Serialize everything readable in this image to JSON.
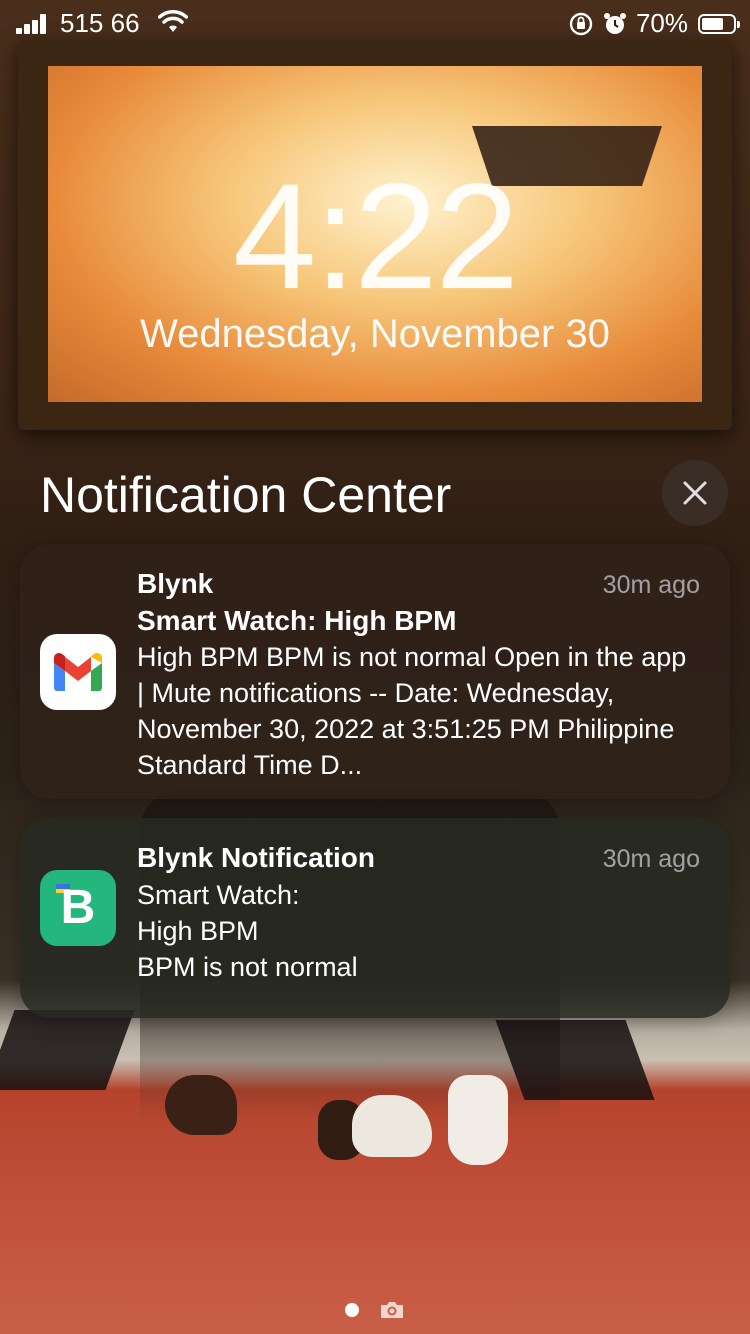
{
  "status_bar": {
    "carrier": "515 66",
    "signal_bars": 4,
    "battery_percent": "70%",
    "battery_level": 0.7,
    "icons": [
      "wifi-icon",
      "orientation-lock-icon",
      "alarm-icon",
      "battery-icon"
    ]
  },
  "lock_screen": {
    "time": "4:22",
    "date": "Wednesday, November 30"
  },
  "notification_center": {
    "title": "Notification Center",
    "close_icon": "close-icon"
  },
  "notifications": [
    {
      "app_icon": "gmail-icon",
      "app_name": "Blynk",
      "time": "30m ago",
      "title": "Smart Watch: High BPM",
      "body": "High BPM BPM is not normal Open in the app | Mute notifications -- Date: Wednesday, November 30, 2022 at 3:51:25 PM Philippine Standard Time D..."
    },
    {
      "app_icon": "blynk-icon",
      "app_icon_letter": "B",
      "app_name": "Blynk Notification",
      "time": "30m ago",
      "lines": [
        "Smart Watch:",
        "High BPM",
        "BPM is not normal"
      ]
    }
  ],
  "bottom": {
    "icons": [
      "page-dot",
      "camera-icon"
    ]
  },
  "colors": {
    "gmail_red": "#EA4335",
    "gmail_blue": "#4285F4",
    "gmail_green": "#34A853",
    "gmail_yellow": "#FBBC04",
    "blynk_green": "#23B77E",
    "notification_bg": "#30221A"
  }
}
